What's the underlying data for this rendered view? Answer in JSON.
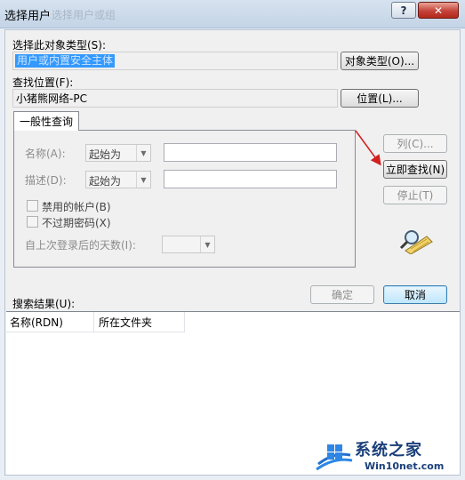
{
  "window": {
    "title": "选择用户",
    "ghost_title": "选择用户或组",
    "help_glyph": "?",
    "close_glyph": "✕"
  },
  "object_type": {
    "label": "选择此对象类型(S):",
    "value": "用户或内置安全主体",
    "button": "对象类型(O)..."
  },
  "location": {
    "label": "查找位置(F):",
    "value": "小猪熊网络-PC",
    "button": "位置(L)..."
  },
  "tab": {
    "label": "一般性查询"
  },
  "query": {
    "name_label": "名称(A):",
    "name_mode": "起始为",
    "desc_label": "描述(D):",
    "desc_mode": "起始为",
    "disabled_accounts": "禁用的帐户(B)",
    "non_expiring_pw": "不过期密码(X)",
    "days_since_login": "自上次登录后的天数(I):"
  },
  "side_buttons": {
    "columns": "列(C)...",
    "find_now": "立即查找(N)",
    "stop": "停止(T)"
  },
  "actions": {
    "ok": "确定",
    "cancel": "取消"
  },
  "results": {
    "label": "搜索结果(U):",
    "columns": [
      "名称(RDN)",
      "所在文件夹"
    ]
  },
  "watermark": {
    "brand": "系统之家",
    "site": "Win10net.com"
  },
  "colors": {
    "selection": "#3399ff",
    "annotation_arrow": "#d21f1f"
  }
}
